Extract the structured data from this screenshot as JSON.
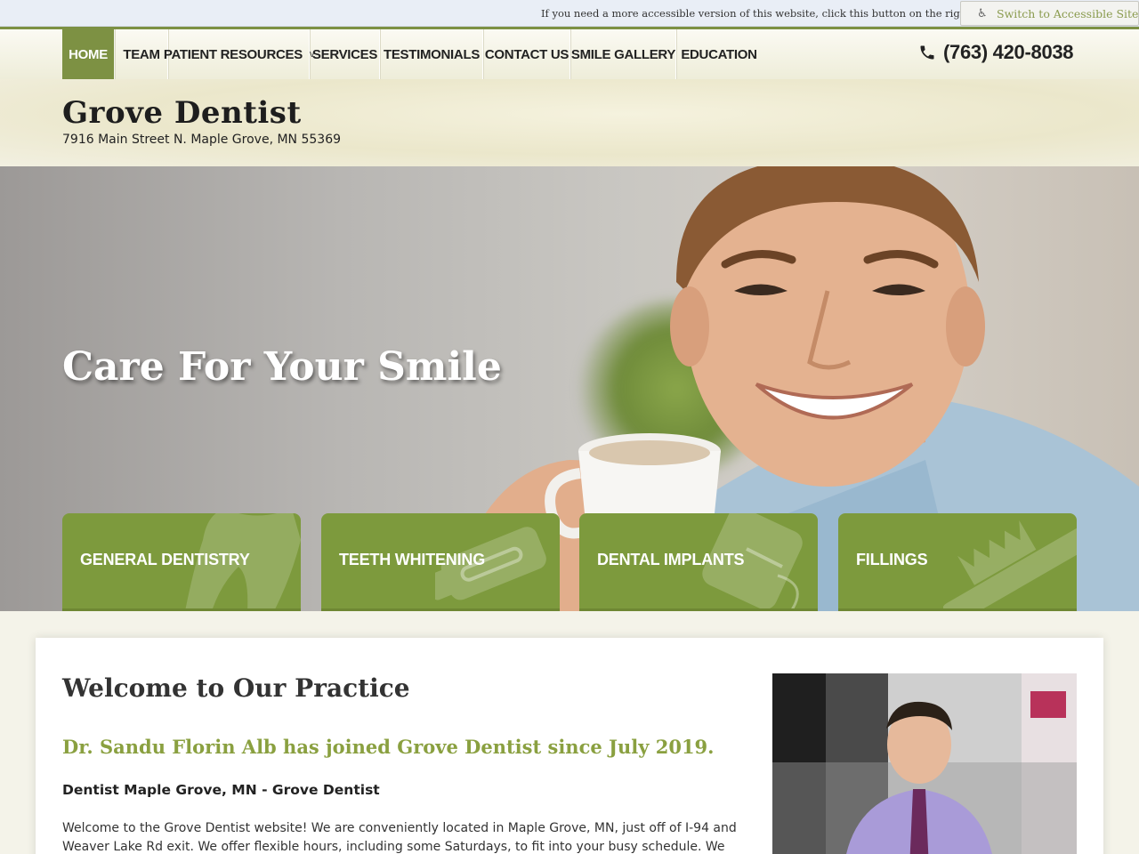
{
  "access_bar": {
    "message": "If you need a more accessible version of this website, click this button on the right.",
    "button_label": "Switch to Accessible Site"
  },
  "nav": {
    "items": [
      {
        "label": "HOME"
      },
      {
        "label": "TEAM"
      },
      {
        "label": "PATIENT RESOURCES",
        "caret": "v"
      },
      {
        "label": "SERVICES"
      },
      {
        "label": "TESTIMONIALS"
      },
      {
        "label": "CONTACT US"
      },
      {
        "label": "SMILE GALLERY"
      },
      {
        "label": "EDUCATION"
      }
    ],
    "phone": "(763) 420-8038"
  },
  "header": {
    "title": "Grove Dentist",
    "address": "7916 Main Street N.  Maple Grove, MN 55369"
  },
  "hero": {
    "headline": "Care For Your Smile",
    "tiles": [
      {
        "label": "GENERAL DENTISTRY",
        "icon": "tooth-icon"
      },
      {
        "label": "TEETH WHITENING",
        "icon": "whitening-tray-icon"
      },
      {
        "label": "DENTAL IMPLANTS",
        "icon": "floss-icon"
      },
      {
        "label": "FILLINGS",
        "icon": "toothbrush-icon"
      }
    ]
  },
  "content": {
    "title": "Welcome to Our Practice",
    "doctor_heading": "Dr. Sandu Florin Alb has joined Grove Dentist since July 2019.",
    "sub_heading": "Dentist Maple Grove, MN - Grove Dentist",
    "intro": "Welcome to the Grove Dentist website! We are conveniently located in Maple Grove, MN, just off of I-94 and Weaver Lake Rd exit. We offer flexible hours, including some Saturdays, to fit into your busy schedule. We offer"
  },
  "colors": {
    "brand_green": "#7d9143",
    "tile_green": "#7d9a3d",
    "heading_green": "#8aa040"
  }
}
